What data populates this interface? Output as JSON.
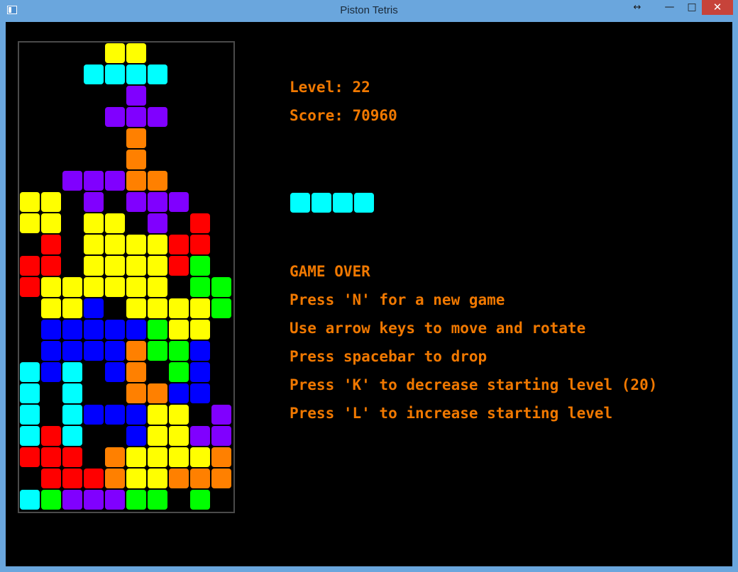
{
  "window": {
    "title": "Piston Tetris",
    "controls": {
      "resize": "↔",
      "minimize": "—",
      "maximize": "□",
      "close": "✕"
    }
  },
  "colors": {
    "Y": "#ffff00",
    "C": "#00ffff",
    "P": "#8000ff",
    "O": "#ff8000",
    "R": "#ff0000",
    "G": "#00ff00",
    "B": "#0000ff"
  },
  "board": {
    "rows": [
      "....YY....",
      "...CCCC...",
      ".....P....",
      "....PPP...",
      ".....O....",
      ".....O....",
      "..PPPOO...",
      "YY.P.PPP..",
      "YY.YY.P.R.",
      ".R.YYYYRR.",
      "RR.YYYYRG.",
      "RYYYYYY.GG",
      ".YYB.YYYYG",
      ".BBBBBGYY.",
      ".BBBBOGGB.",
      "CBC.BO.GB.",
      "C.C..OOBB.",
      "C.CBBBYY.P",
      "CRC..BYYPP",
      "RRR.OYYYYO",
      ".RRROYYOOO",
      "CGPPPGG.G."
    ]
  },
  "hud": {
    "level": "Level: 22",
    "score": "Score: 70960",
    "game_over": "GAME OVER",
    "help_new": "Press 'N' for a new game",
    "help_move": "Use arrow keys to move and rotate",
    "help_drop": "Press spacebar to drop",
    "help_decrease": "Press 'K' to decrease starting level (20)",
    "help_increase": "Press 'L' to increase starting level"
  },
  "next_piece": {
    "type": "I",
    "rows": [
      "CCCC"
    ]
  }
}
